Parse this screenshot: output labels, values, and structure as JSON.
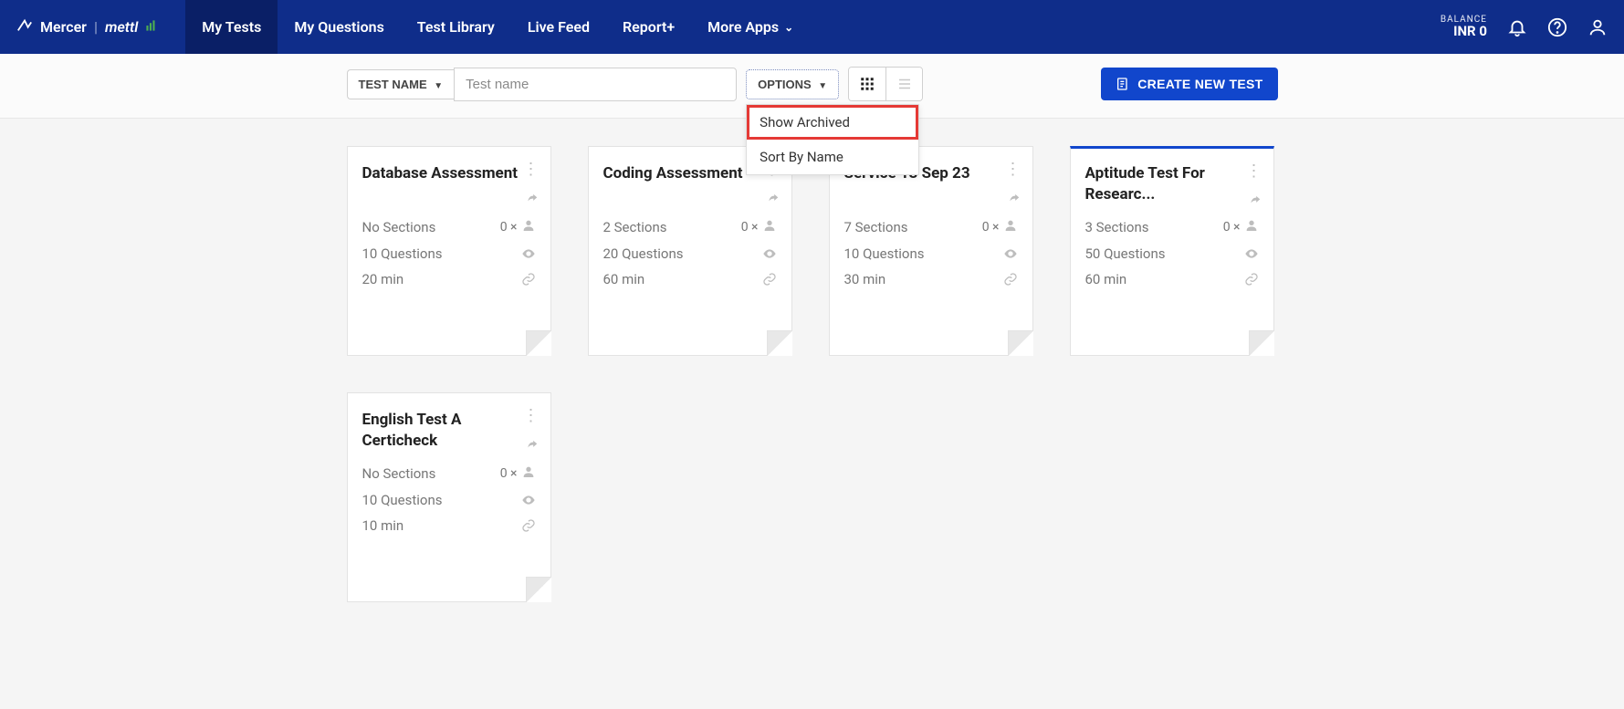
{
  "brand": {
    "name": "Mercer",
    "sub": "mettl"
  },
  "nav": {
    "items": [
      {
        "label": "My Tests",
        "active": true
      },
      {
        "label": "My Questions"
      },
      {
        "label": "Test Library"
      },
      {
        "label": "Live Feed"
      },
      {
        "label": "Report+"
      },
      {
        "label": "More Apps",
        "chev": true
      }
    ]
  },
  "balance": {
    "label": "BALANCE",
    "value": "INR 0"
  },
  "toolbar": {
    "filter_label": "TEST NAME",
    "search_placeholder": "Test name",
    "options_label": "OPTIONS",
    "options_menu": [
      "Show Archived",
      "Sort By Name"
    ],
    "create_label": "CREATE NEW TEST"
  },
  "tests": [
    {
      "title": "Database Assessment",
      "sections": "No Sections",
      "questions": "10 Questions",
      "duration": "20 min",
      "count": "0 ×"
    },
    {
      "title": "Coding Assessment",
      "sections": "2 Sections",
      "questions": "20 Questions",
      "duration": "60 min",
      "count": "0 ×"
    },
    {
      "title": "Service 13 Sep 23",
      "sections": "7 Sections",
      "questions": "10 Questions",
      "duration": "30 min",
      "count": "0 ×",
      "partial_left": true
    },
    {
      "title": "Aptitude Test For Researc...",
      "sections": "3 Sections",
      "questions": "50 Questions",
      "duration": "60 min",
      "count": "0 ×",
      "active": true
    },
    {
      "title": "English Test A Certicheck",
      "sections": "No Sections",
      "questions": "10 Questions",
      "duration": "10 min",
      "count": "0 ×"
    }
  ]
}
